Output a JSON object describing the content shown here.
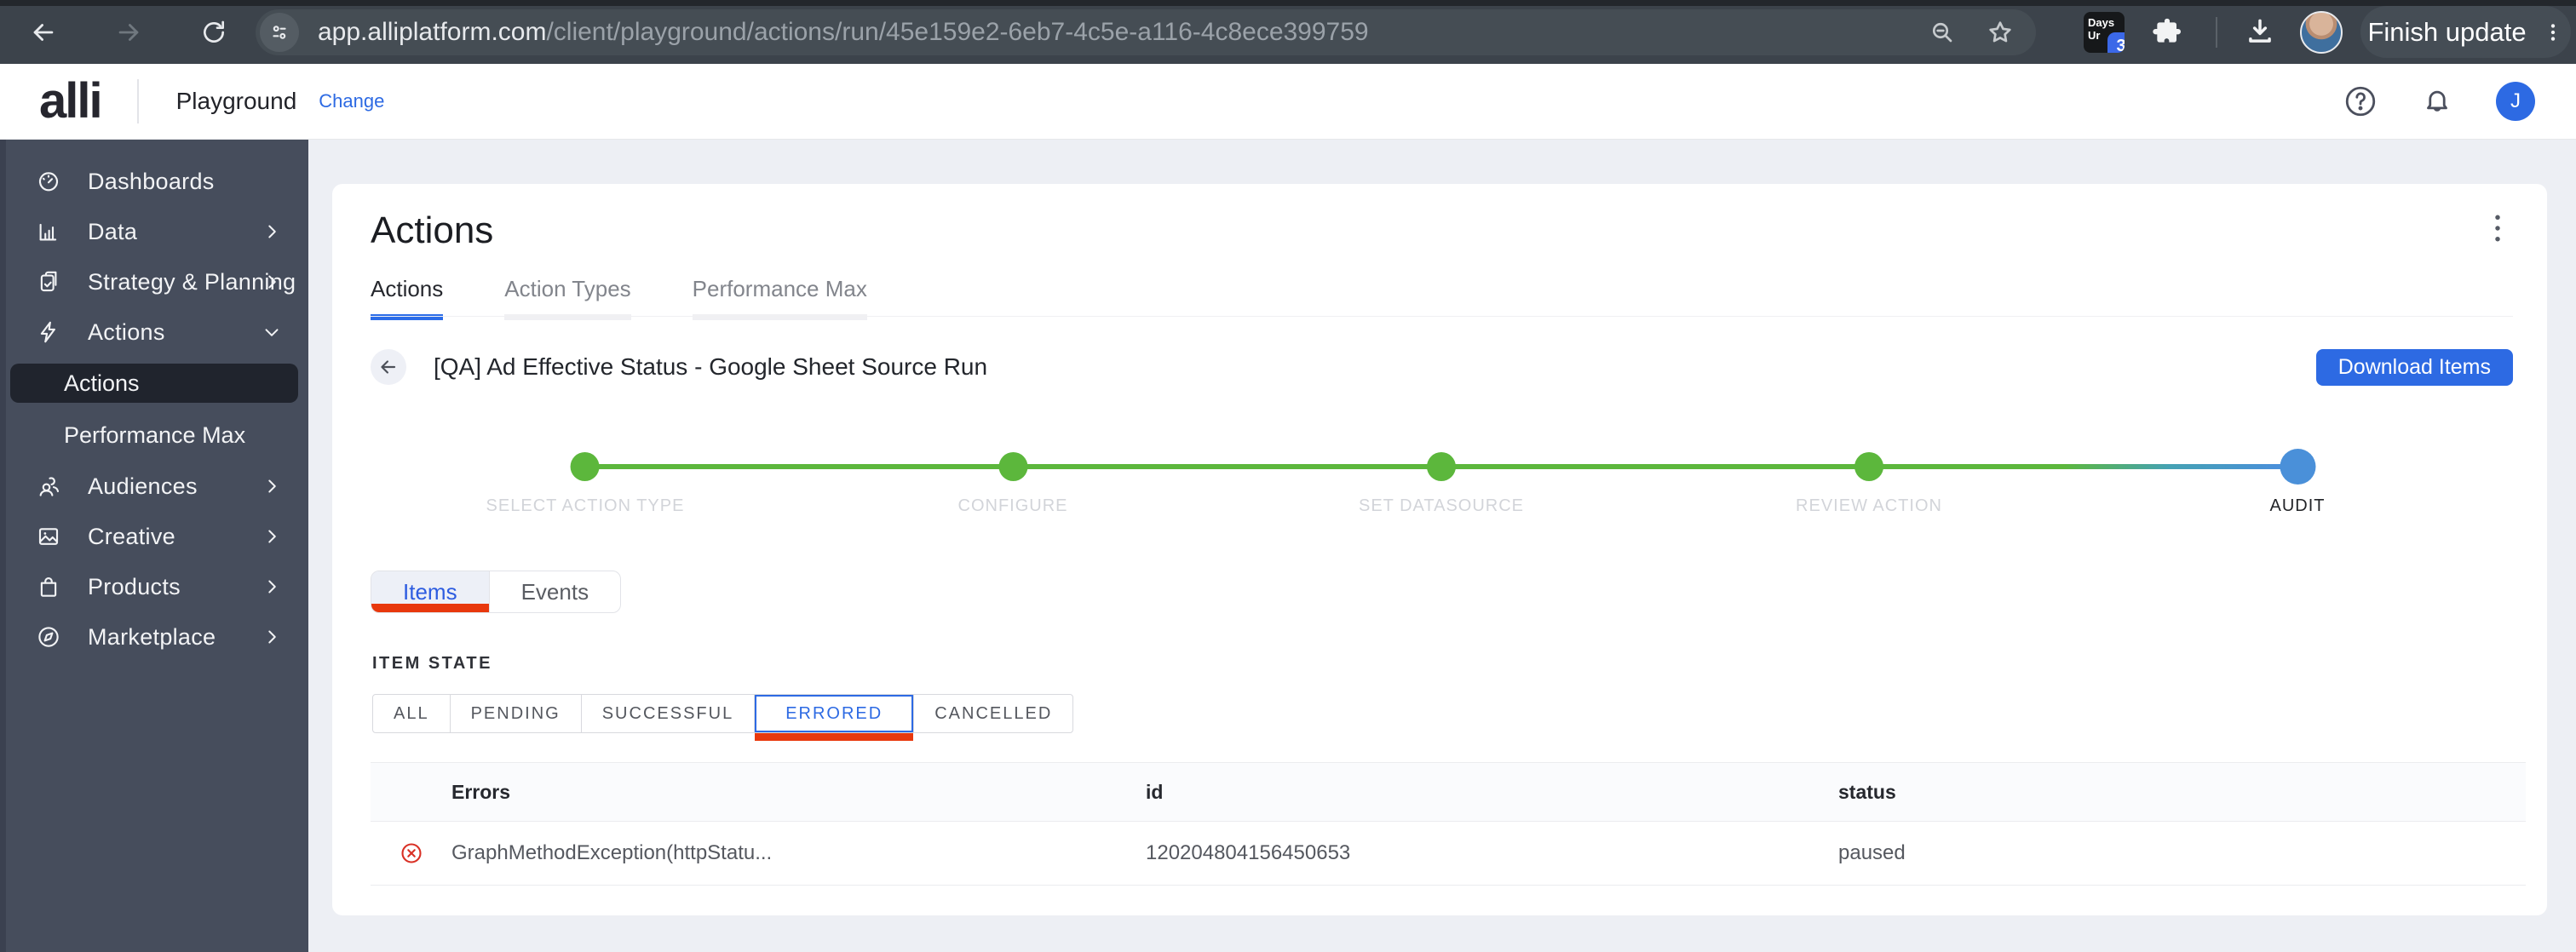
{
  "browser": {
    "url_domain": "app.alliplatform.com",
    "url_path": "/client/playground/actions/run/45e159e2-6eb7-4c5e-a116-4c8ece399759",
    "extension_label_line1": "Days",
    "extension_label_line2": "Ur",
    "extension_badge": "3",
    "update_button": "Finish update"
  },
  "header": {
    "logo": "alli",
    "workspace": "Playground",
    "change_link": "Change",
    "avatar_initial": "J"
  },
  "sidebar": {
    "items": [
      {
        "label": "Dashboards",
        "icon": "gauge-icon"
      },
      {
        "label": "Data",
        "icon": "bar-chart-icon",
        "chevron": "right"
      },
      {
        "label": "Strategy & Planning",
        "icon": "clipboard-check-icon",
        "chevron": "right"
      },
      {
        "label": "Actions",
        "icon": "lightning-icon",
        "chevron": "down"
      },
      {
        "label": "Actions",
        "sub": true,
        "selected": true
      },
      {
        "label": "Performance Max",
        "sub": true
      },
      {
        "label": "Audiences",
        "icon": "people-icon",
        "chevron": "right"
      },
      {
        "label": "Creative",
        "icon": "image-icon",
        "chevron": "right"
      },
      {
        "label": "Products",
        "icon": "shopping-bag-icon",
        "chevron": "right"
      },
      {
        "label": "Marketplace",
        "icon": "compass-icon",
        "chevron": "right"
      }
    ]
  },
  "main": {
    "page_title": "Actions",
    "tabs": [
      {
        "label": "Actions",
        "active": true
      },
      {
        "label": "Action Types",
        "active": false
      },
      {
        "label": "Performance Max",
        "active": false
      }
    ],
    "run_title": "[QA] Ad Effective Status - Google Sheet Source Run",
    "download_button": "Download Items",
    "stepper": {
      "steps": [
        {
          "label": "SELECT ACTION TYPE",
          "state": "done"
        },
        {
          "label": "CONFIGURE",
          "state": "done"
        },
        {
          "label": "SET DATASOURCE",
          "state": "done"
        },
        {
          "label": "REVIEW ACTION",
          "state": "done"
        },
        {
          "label": "AUDIT",
          "state": "current"
        }
      ]
    },
    "view_tabs": [
      {
        "label": "Items",
        "active": true
      },
      {
        "label": "Events",
        "active": false
      }
    ],
    "item_state_label": "ITEM STATE",
    "filters": [
      {
        "label": "ALL",
        "selected": false
      },
      {
        "label": "PENDING",
        "selected": false
      },
      {
        "label": "SUCCESSFUL",
        "selected": false
      },
      {
        "label": "ERRORED",
        "selected": true
      },
      {
        "label": "CANCELLED",
        "selected": false
      }
    ],
    "table": {
      "columns": [
        "Errors",
        "id",
        "status"
      ],
      "rows": [
        {
          "error": "GraphMethodException(httpStatu...",
          "id": "120204804156450653",
          "status": "paused"
        }
      ]
    }
  },
  "colors": {
    "accent_blue": "#2d6ae3",
    "stepper_green": "#5cb73c",
    "audit_blue": "#4a90d9",
    "tab_red": "#e8380d",
    "error_red": "#d93025",
    "sidebar_bg": "#464d5c",
    "chrome_bg": "#3c434b",
    "page_bg": "#edeff4"
  },
  "icons": {
    "browser": [
      "back-icon",
      "forward-icon",
      "reload-icon",
      "tune-icon",
      "zoom-out-icon",
      "star-icon",
      "puzzle-icon",
      "download-icon",
      "kebab-icon"
    ],
    "app": [
      "help-icon",
      "bell-icon",
      "back-arrow-icon",
      "error-circle-icon"
    ]
  }
}
